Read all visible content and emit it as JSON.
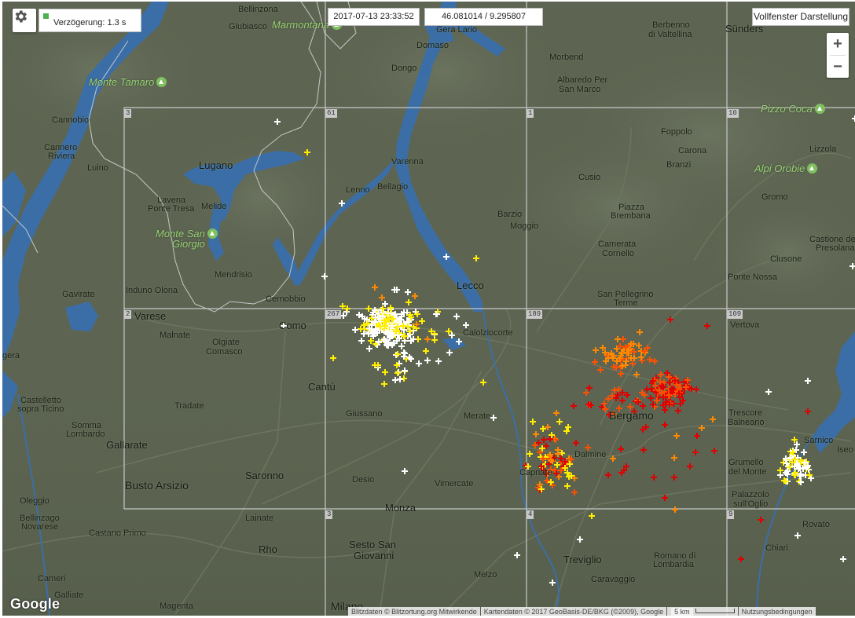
{
  "controls": {
    "delay_text": "Verzögerung: 1.3 s",
    "timestamp": "2017-07-13 23:33:52",
    "coordinates": "46.081014 / 9.295807",
    "fullscreen_label": "Vollfenster Darstellung",
    "zoom_in": "+",
    "zoom_out": "−"
  },
  "icons": [
    "gear-icon"
  ],
  "grid_labels": [
    "3",
    "61",
    "1",
    "10",
    "2",
    "267",
    "189",
    "109",
    "3",
    "4",
    "9"
  ],
  "places": {
    "bellinzona": "Bellinzona",
    "giubiasco": "Giubiasco",
    "marmontana": "Marmontana",
    "gera_lario": "Gera Lario",
    "berbenno": "Berbenno",
    "di_valtellina": "di Valtellina",
    "sundrs": "Sünders",
    "domaso": "Domaso",
    "morbegno": "Morbend",
    "dongo": "Dongo",
    "albaredo": "Albaredo Per",
    "san_marco": "San Marco",
    "monte_tamaro": "Monte Tamaro",
    "pizzo_coca": "Pizzo Coca",
    "cannobio": "Cannobio",
    "foppolo": "Foppolo",
    "carona": "Carona",
    "cannero": "Cannero",
    "riviera": "Riviera",
    "lizzola": "Lizzola",
    "branzi": "Branzi",
    "luino": "Luino",
    "lugano": "Lugano",
    "varenna": "Varenna",
    "alpi_orobie": "Alpi Orobie",
    "cusio": "Cusio",
    "lenno": "Lenno",
    "bellagio": "Bellagio",
    "gromo": "Gromo",
    "lavena": "Lavena",
    "ponte_tresa": "Ponte Tresa",
    "melide": "Melide",
    "piazza": "Piazza",
    "brembana": "Brembana",
    "barzio": "Barzio",
    "moggio": "Moggio",
    "monte_san": "Monte San",
    "giorgio": "Giorgio",
    "castione": "Castione de",
    "presolana": "Presolana",
    "camerata": "Camerata",
    "cornello": "Cornello",
    "clusone": "Clusone",
    "mendrisio": "Mendrisio",
    "ponte_nossa": "Ponte Nossa",
    "induno": "Induno Olona",
    "gavirate": "Gavirate",
    "cernobbio": "Cernobbio",
    "lecco": "Lecco",
    "san_pellegrino": "San Pellegrino",
    "terme": "Terme",
    "varese": "Varese",
    "como": "Como",
    "calolziocorte": "Calolziocorte",
    "vertova": "Vertova",
    "malnate": "Malnate",
    "olgiate": "Olgiate",
    "comasco": "Comasco",
    "gera": "gera",
    "cantu": "Cantù",
    "castelletto": "Castelletto",
    "sopra_ticino": "sopra Ticino",
    "tradate": "Tradate",
    "somma": "Somma",
    "lombardo": "Lombardo",
    "giussano": "Giussano",
    "merate": "Merate",
    "bergamo": "Bergamo",
    "trescore": "Trescore",
    "balneario": "Balneario",
    "sarnico": "Sarnico",
    "iseo": "Iseo",
    "gallarate": "Gallarate",
    "dalmine": "Dalmine",
    "grumello": "Grumello",
    "del_monte": "del Monte",
    "busto_arsizio": "Busto Arsizio",
    "saronno": "Saronno",
    "desio": "Desio",
    "vimercate": "Vimercate",
    "capriate": "Capriate",
    "palazzolo": "Palazzolo",
    "sull_oglio": "sull'Oglio",
    "oleggio": "Oleggio",
    "bellinzago": "Bellinzago",
    "novarese": "Novarese",
    "lainate": "Lainate",
    "monza": "Monza",
    "rovato": "Rovato",
    "castano": "Castano Primo",
    "rho": "Rho",
    "sesto": "Sesto San",
    "giovanni": "Giovanni",
    "chiari": "Chiari",
    "treviglio": "Treviglio",
    "romano": "Romano di",
    "lombardia": "Lombardia",
    "cameri": "Cameri",
    "melzo": "Melzo",
    "caravaggio": "Caravaggio",
    "galliate": "Galliate",
    "magenta": "Magenta",
    "milano": "Milano"
  },
  "footer": {
    "google": "Google",
    "blitz": "Blitzdaten © Blitzortung.org Mitwirkende",
    "kartendaten": "Kartendaten © 2017 GeoBasis-DE/BKG (©2009), Google",
    "scale": "5 km",
    "terms": "Nutzungsbedingungen"
  },
  "colors": {
    "land": "#5d6552",
    "water": "#3b6ea6",
    "grid": "#c8c8c8",
    "strike_new": "#ffffff",
    "strike_mid": "#ffee00",
    "strike_old1": "#ff8800",
    "strike_old2": "#ff5000",
    "strike_oldest": "#e00000",
    "green": "#4caf50"
  }
}
